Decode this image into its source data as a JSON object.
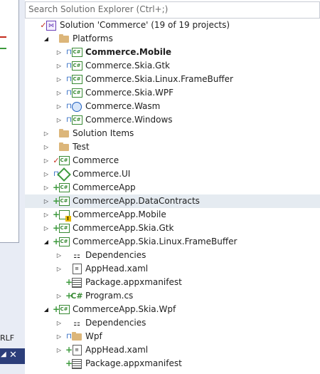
{
  "search": {
    "placeholder": "Search Solution Explorer (Ctrl+;)"
  },
  "status_bar": {
    "line_ending": "RLF"
  },
  "tree": [
    {
      "name": "solution-node",
      "label": "Solution 'Commerce' (19 of 19 projects)",
      "level": 0,
      "expander": "",
      "status": "check",
      "icon": "solution-icon",
      "bold": false
    },
    {
      "name": "folder-platforms",
      "label": "Platforms",
      "level": 1,
      "expander": "expanded",
      "status": "",
      "icon": "folder-icon",
      "bold": false
    },
    {
      "name": "project-commerce-mobile",
      "label": "Commerce.Mobile",
      "level": 2,
      "expander": "collapsed",
      "status": "lock",
      "icon": "csharp-project-icon",
      "bold": true
    },
    {
      "name": "project-commerce-skia-gtk",
      "label": "Commerce.Skia.Gtk",
      "level": 2,
      "expander": "collapsed",
      "status": "lock",
      "icon": "csharp-project-icon",
      "bold": false
    },
    {
      "name": "project-commerce-skia-linux-framebuffer",
      "label": "Commerce.Skia.Linux.FrameBuffer",
      "level": 2,
      "expander": "collapsed",
      "status": "lock",
      "icon": "csharp-project-icon",
      "bold": false
    },
    {
      "name": "project-commerce-skia-wpf",
      "label": "Commerce.Skia.WPF",
      "level": 2,
      "expander": "collapsed",
      "status": "lock",
      "icon": "csharp-project-icon",
      "bold": false
    },
    {
      "name": "project-commerce-wasm",
      "label": "Commerce.Wasm",
      "level": 2,
      "expander": "collapsed",
      "status": "lock",
      "icon": "web-project-icon",
      "bold": false
    },
    {
      "name": "project-commerce-windows",
      "label": "Commerce.Windows",
      "level": 2,
      "expander": "collapsed",
      "status": "lock",
      "icon": "csharp-project-icon",
      "bold": false
    },
    {
      "name": "folder-solution-items",
      "label": "Solution Items",
      "level": 1,
      "expander": "collapsed",
      "status": "",
      "icon": "folder-icon",
      "bold": false
    },
    {
      "name": "folder-test",
      "label": "Test",
      "level": 1,
      "expander": "collapsed",
      "status": "",
      "icon": "folder-icon",
      "bold": false
    },
    {
      "name": "project-commerce",
      "label": "Commerce",
      "level": 1,
      "expander": "collapsed",
      "status": "check",
      "icon": "csharp-project-icon",
      "bold": false
    },
    {
      "name": "project-commerce-ui",
      "label": "Commerce.UI",
      "level": 1,
      "expander": "collapsed",
      "status": "lock",
      "icon": "shared-project-icon",
      "bold": false
    },
    {
      "name": "project-commerceapp",
      "label": "CommerceApp",
      "level": 1,
      "expander": "collapsed",
      "status": "plus",
      "icon": "csharp-project-icon",
      "bold": false
    },
    {
      "name": "project-commerceapp-datacontracts",
      "label": "CommerceApp.DataContracts",
      "level": 1,
      "expander": "collapsed",
      "status": "plus",
      "icon": "csharp-project-icon",
      "bold": false,
      "selected": true
    },
    {
      "name": "project-commerceapp-mobile",
      "label": "CommerceApp.Mobile",
      "level": 1,
      "expander": "collapsed",
      "status": "plus",
      "icon": "warning-project-icon",
      "bold": false
    },
    {
      "name": "project-commerceapp-skia-gtk",
      "label": "CommerceApp.Skia.Gtk",
      "level": 1,
      "expander": "collapsed",
      "status": "plus",
      "icon": "csharp-project-icon",
      "bold": false
    },
    {
      "name": "project-commerceapp-skia-linux-framebuffer",
      "label": "CommerceApp.Skia.Linux.FrameBuffer",
      "level": 1,
      "expander": "expanded",
      "status": "plus",
      "icon": "csharp-project-icon",
      "bold": false
    },
    {
      "name": "node-dependencies",
      "label": "Dependencies",
      "level": 2,
      "expander": "collapsed",
      "status": "",
      "icon": "dependencies-icon",
      "bold": false
    },
    {
      "name": "file-apphead-xaml",
      "label": "AppHead.xaml",
      "level": 2,
      "expander": "collapsed",
      "status": "",
      "icon": "xaml-file-icon",
      "bold": false
    },
    {
      "name": "file-package-appxmanifest",
      "label": "Package.appxmanifest",
      "level": 2,
      "expander": "",
      "status": "plus",
      "icon": "manifest-file-icon",
      "bold": false
    },
    {
      "name": "file-program-cs",
      "label": "Program.cs",
      "level": 2,
      "expander": "collapsed",
      "status": "plus",
      "icon": "csharp-file-icon",
      "bold": false
    },
    {
      "name": "project-commerceapp-skia-wpf",
      "label": "CommerceApp.Skia.Wpf",
      "level": 1,
      "expander": "expanded",
      "status": "plus",
      "icon": "csharp-project-icon",
      "bold": false
    },
    {
      "name": "node-dependencies-wpf",
      "label": "Dependencies",
      "level": 2,
      "expander": "collapsed",
      "status": "",
      "icon": "dependencies-icon",
      "bold": false
    },
    {
      "name": "folder-wpf",
      "label": "Wpf",
      "level": 2,
      "expander": "collapsed",
      "status": "lock",
      "icon": "folder-icon",
      "bold": false
    },
    {
      "name": "file-apphead-xaml-wpf",
      "label": "AppHead.xaml",
      "level": 2,
      "expander": "collapsed",
      "status": "plus",
      "icon": "xaml-file-icon",
      "bold": false
    },
    {
      "name": "file-package-appxmanifest-wpf",
      "label": "Package.appxmanifest",
      "level": 2,
      "expander": "",
      "status": "plus",
      "icon": "manifest-file-icon",
      "bold": false
    }
  ]
}
